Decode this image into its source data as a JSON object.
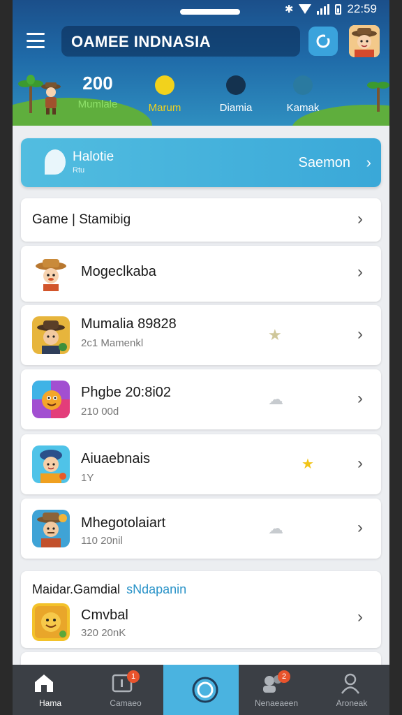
{
  "status_bar": {
    "time": "22:59"
  },
  "header": {
    "title": "OAMEE INDNASIA",
    "stats": [
      {
        "value": "200",
        "label": "Mumlale",
        "color": "#8ee06a"
      },
      {
        "value": "",
        "label": "Marum",
        "color": "#f2d21c"
      },
      {
        "value": "",
        "label": "Diamia",
        "color": "#ffffff"
      },
      {
        "value": "",
        "label": "Kamak",
        "color": "#ffffff"
      }
    ]
  },
  "banner": {
    "title": "Halotie",
    "subtitle": "Rtu",
    "action": "Saemon"
  },
  "section_row": {
    "label": "Game | Stamibig"
  },
  "games": [
    {
      "name": "Mogeclkaba",
      "sub": "",
      "icon": "explorer-hat-icon",
      "deco": ""
    },
    {
      "name": "Mumalia 89828",
      "sub": "2c1 Mamenkl",
      "icon": "cowboy-avatar-icon",
      "deco": "star-gray"
    },
    {
      "name": "Phgbe 20:8i02",
      "sub": "210 00d",
      "icon": "colorful-creature-icon",
      "deco": "cloud-gray"
    },
    {
      "name": "Aiuaebnais",
      "sub": "1Y",
      "icon": "explorer-girl-icon",
      "deco": "star-yellow"
    },
    {
      "name": "Mhegotolaiart",
      "sub": "110 20nil",
      "icon": "adventurer-icon",
      "deco": "cloud-gray"
    }
  ],
  "section2": {
    "title": "Maidar.Gamdial",
    "link": "sNdapanin",
    "item": {
      "name": "Cmvbal",
      "sub": "320 20nK",
      "icon": "smiley-icon"
    }
  },
  "nav": {
    "items": [
      {
        "label": "Hama",
        "badge": ""
      },
      {
        "label": "Camaeo",
        "badge": "1"
      },
      {
        "label": "",
        "badge": ""
      },
      {
        "label": "Nenaeaeen",
        "badge": "2"
      },
      {
        "label": "Aroneak",
        "badge": ""
      }
    ]
  },
  "colors": {
    "accent": "#4ab3e0",
    "header": "#1f6aa8",
    "nav": "#3b3f45"
  }
}
